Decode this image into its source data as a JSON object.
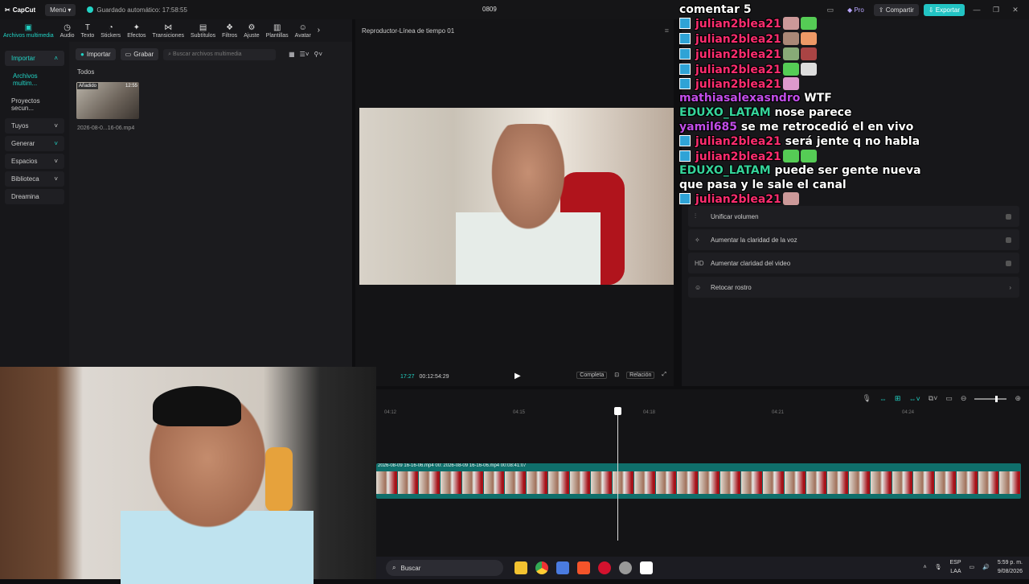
{
  "topbar": {
    "logo": "CapCut",
    "menu_label": "Menú",
    "autosave": "Guardado automático: 17:58:55",
    "project_name": "0809",
    "pro_label": "Pro",
    "share_label": "Compartir",
    "export_label": "Exportar"
  },
  "tools": [
    {
      "label": "Archivos multimedia",
      "icon": "media-icon"
    },
    {
      "label": "Audio",
      "icon": "audio-icon"
    },
    {
      "label": "Texto",
      "icon": "text-icon"
    },
    {
      "label": "Stickers",
      "icon": "sticker-icon"
    },
    {
      "label": "Efectos",
      "icon": "effects-icon"
    },
    {
      "label": "Transiciones",
      "icon": "transition-icon"
    },
    {
      "label": "Subtítulos",
      "icon": "subtitle-icon"
    },
    {
      "label": "Filtros",
      "icon": "filter-icon"
    },
    {
      "label": "Ajuste",
      "icon": "adjust-icon"
    },
    {
      "label": "Plantillas",
      "icon": "template-icon"
    },
    {
      "label": "Avatar",
      "icon": "avatar-icon"
    }
  ],
  "leftnav": {
    "items": [
      "Importar",
      "Archivos multim...",
      "Proyectos secun...",
      "Tuyos",
      "Generar",
      "Espacios",
      "Biblioteca",
      "Dreamina"
    ]
  },
  "media": {
    "import_label": "Importar",
    "record_label": "Grabar",
    "search_placeholder": "Buscar archivos multimedia",
    "section_label": "Todos",
    "clip": {
      "tag": "Añadido",
      "duration": "12:55",
      "name": "2026-08-0...16-06.mp4"
    }
  },
  "player": {
    "title": "Reproductor-Línea de tiempo 01",
    "current_time": "17:27",
    "total_time": "00:12:54:29",
    "full_label": "Completa",
    "ratio_label": "Relación"
  },
  "details": {
    "rows": [
      {
        "label": "Unificar volumen",
        "icon": "sliders-icon"
      },
      {
        "label": "Aumentar la claridad de la voz",
        "icon": "sparkle-icon"
      },
      {
        "label": "Aumentar claridad del video",
        "icon": "hd-icon"
      },
      {
        "label": "Retocar rostro",
        "icon": "face-icon"
      }
    ]
  },
  "timeline": {
    "ticks": [
      "04:12",
      "04:15",
      "04:18",
      "04:21",
      "04:24"
    ],
    "clip_label_1": "2026-08-09 16-16-06.mp4",
    "clip_label_2": "00:",
    "clip_label_3": "2026-08-09 16-16-06.mp4",
    "clip_label_4": "00:08:41:07"
  },
  "chat": [
    {
      "user": "comentar 5",
      "text": "",
      "color": "u-white"
    },
    {
      "user": "julian2blea21",
      "text": "",
      "color": "u-pink"
    },
    {
      "user": "julian2blea21",
      "text": "",
      "color": "u-pink"
    },
    {
      "user": "julian2blea21",
      "text": "",
      "color": "u-pink"
    },
    {
      "user": "julian2blea21",
      "text": "",
      "color": "u-pink"
    },
    {
      "user": "julian2blea21",
      "text": "",
      "color": "u-pink"
    },
    {
      "user": "mathiasalexasndro",
      "text": "WTF",
      "color": "u-purple"
    },
    {
      "user": "EDUXO_LATAM",
      "text": "nose parece",
      "color": "u-green"
    },
    {
      "user": "yamil685",
      "text": "se me retrocedió el en vivo",
      "color": "u-purple"
    },
    {
      "user": "julian2blea21",
      "text": "será jente q no habla",
      "color": "u-pink"
    },
    {
      "user": "julian2blea21",
      "text": "",
      "color": "u-pink"
    },
    {
      "user": "EDUXO_LATAM",
      "text": "puede ser gente nueva",
      "color": "u-green"
    },
    {
      "user": "",
      "text": "que pasa y le sale el canal",
      "color": "u-white"
    },
    {
      "user": "julian2blea21",
      "text": "",
      "color": "u-pink"
    }
  ],
  "taskbar": {
    "search_label": "Buscar",
    "lang_1": "ESP",
    "lang_2": "LAA",
    "time": "5:59 p. m.",
    "date": "9/08/2026"
  }
}
